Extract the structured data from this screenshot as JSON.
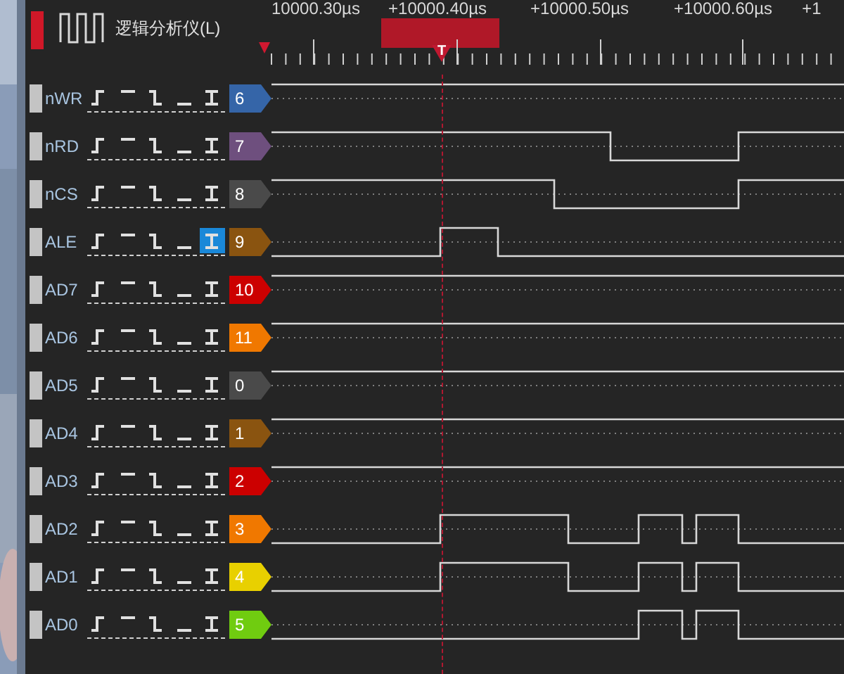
{
  "title": "逻辑分析仪(L)",
  "timeline": {
    "labels": [
      "10000.30µs",
      "+10000.40µs",
      "+10000.50µs",
      "+10000.60µs",
      "+1"
    ],
    "cursor_label": "T"
  },
  "channels": [
    {
      "name": "nWR",
      "index": "6",
      "color": "#3565a8",
      "triggers": [
        {
          "kind": "rising",
          "selected": false
        },
        {
          "kind": "high",
          "selected": false
        },
        {
          "kind": "falling",
          "selected": false
        },
        {
          "kind": "low",
          "selected": false
        },
        {
          "kind": "either",
          "selected": false
        }
      ]
    },
    {
      "name": "nRD",
      "index": "7",
      "color": "#6e4f7e",
      "triggers": [
        {
          "kind": "rising",
          "selected": false
        },
        {
          "kind": "high",
          "selected": false
        },
        {
          "kind": "falling",
          "selected": false
        },
        {
          "kind": "low",
          "selected": false
        },
        {
          "kind": "either",
          "selected": false
        }
      ]
    },
    {
      "name": "nCS",
      "index": "8",
      "color": "#4a4a4a",
      "triggers": [
        {
          "kind": "rising",
          "selected": false
        },
        {
          "kind": "high",
          "selected": false
        },
        {
          "kind": "falling",
          "selected": false
        },
        {
          "kind": "low",
          "selected": false
        },
        {
          "kind": "either",
          "selected": false
        }
      ]
    },
    {
      "name": "ALE",
      "index": "9",
      "color": "#8a5410",
      "triggers": [
        {
          "kind": "rising",
          "selected": false
        },
        {
          "kind": "high",
          "selected": false
        },
        {
          "kind": "falling",
          "selected": false
        },
        {
          "kind": "low",
          "selected": false
        },
        {
          "kind": "either",
          "selected": true
        }
      ]
    },
    {
      "name": "AD7",
      "index": "10",
      "color": "#cc0000",
      "triggers": [
        {
          "kind": "rising",
          "selected": false
        },
        {
          "kind": "high",
          "selected": false
        },
        {
          "kind": "falling",
          "selected": false
        },
        {
          "kind": "low",
          "selected": false
        },
        {
          "kind": "either",
          "selected": false
        }
      ]
    },
    {
      "name": "AD6",
      "index": "11",
      "color": "#f07800",
      "triggers": [
        {
          "kind": "rising",
          "selected": false
        },
        {
          "kind": "high",
          "selected": false
        },
        {
          "kind": "falling",
          "selected": false
        },
        {
          "kind": "low",
          "selected": false
        },
        {
          "kind": "either",
          "selected": false
        }
      ]
    },
    {
      "name": "AD5",
      "index": "0",
      "color": "#4a4a4a",
      "triggers": [
        {
          "kind": "rising",
          "selected": false
        },
        {
          "kind": "high",
          "selected": false
        },
        {
          "kind": "falling",
          "selected": false
        },
        {
          "kind": "low",
          "selected": false
        },
        {
          "kind": "either",
          "selected": false
        }
      ]
    },
    {
      "name": "AD4",
      "index": "1",
      "color": "#8a5410",
      "triggers": [
        {
          "kind": "rising",
          "selected": false
        },
        {
          "kind": "high",
          "selected": false
        },
        {
          "kind": "falling",
          "selected": false
        },
        {
          "kind": "low",
          "selected": false
        },
        {
          "kind": "either",
          "selected": false
        }
      ]
    },
    {
      "name": "AD3",
      "index": "2",
      "color": "#cc0000",
      "triggers": [
        {
          "kind": "rising",
          "selected": false
        },
        {
          "kind": "high",
          "selected": false
        },
        {
          "kind": "falling",
          "selected": false
        },
        {
          "kind": "low",
          "selected": false
        },
        {
          "kind": "either",
          "selected": false
        }
      ]
    },
    {
      "name": "AD2",
      "index": "3",
      "color": "#f07800",
      "triggers": [
        {
          "kind": "rising",
          "selected": false
        },
        {
          "kind": "high",
          "selected": false
        },
        {
          "kind": "falling",
          "selected": false
        },
        {
          "kind": "low",
          "selected": false
        },
        {
          "kind": "either",
          "selected": false
        }
      ]
    },
    {
      "name": "AD1",
      "index": "4",
      "color": "#e8d000",
      "triggers": [
        {
          "kind": "rising",
          "selected": false
        },
        {
          "kind": "high",
          "selected": false
        },
        {
          "kind": "falling",
          "selected": false
        },
        {
          "kind": "low",
          "selected": false
        },
        {
          "kind": "either",
          "selected": false
        }
      ]
    },
    {
      "name": "AD0",
      "index": "5",
      "color": "#70cc10",
      "triggers": [
        {
          "kind": "rising",
          "selected": false
        },
        {
          "kind": "high",
          "selected": false
        },
        {
          "kind": "falling",
          "selected": false
        },
        {
          "kind": "low",
          "selected": false
        },
        {
          "kind": "either",
          "selected": false
        }
      ]
    }
  ]
}
